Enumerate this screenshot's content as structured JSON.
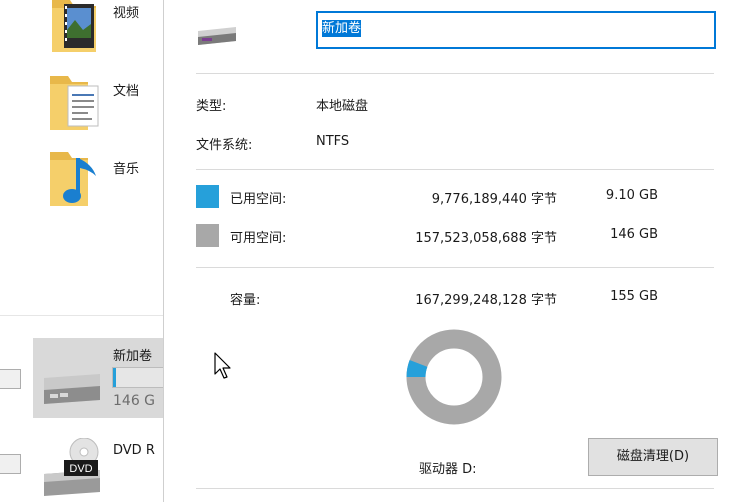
{
  "explorer": {
    "libraries": [
      {
        "label": "视频",
        "icon": "video-folder-icon"
      },
      {
        "label": "文档",
        "icon": "documents-folder-icon"
      },
      {
        "label": "音乐",
        "icon": "music-folder-icon"
      }
    ],
    "drives": [
      {
        "label": "新加卷",
        "size_text": "146 G",
        "icon": "hard-drive-icon",
        "usage": 0.058
      },
      {
        "label": "DVD R",
        "icon": "dvd-drive-icon",
        "badge": "DVD"
      }
    ]
  },
  "properties": {
    "name_value": "新加卷",
    "type_label": "类型:",
    "type_value": "本地磁盘",
    "fs_label": "文件系统:",
    "fs_value": "NTFS",
    "used": {
      "label": "已用空间:",
      "bytes": "9,776,189,440 字节",
      "gb": "9.10 GB",
      "color": "#26a0da"
    },
    "free": {
      "label": "可用空间:",
      "bytes": "157,523,058,688 字节",
      "gb": "146 GB",
      "color": "#a8a8a8"
    },
    "capacity": {
      "label": "容量:",
      "bytes": "167,299,248,128 字节",
      "gb": "155 GB"
    },
    "drive_label": "驱动器 D:",
    "cleanup_button": "磁盘清理(D)",
    "used_fraction": 0.058
  }
}
